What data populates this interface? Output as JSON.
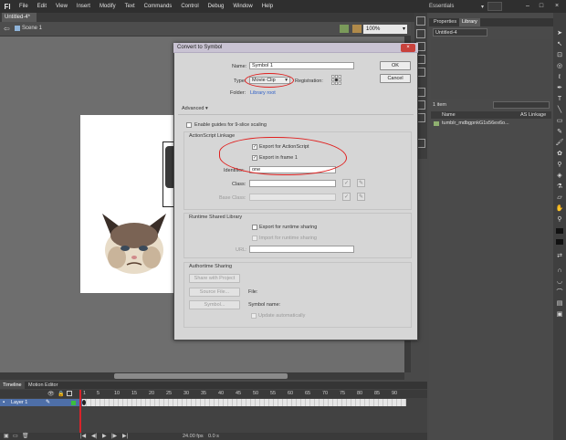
{
  "menubar": {
    "logo": "Fl",
    "items": [
      "File",
      "Edit",
      "View",
      "Insert",
      "Modify",
      "Text",
      "Commands",
      "Control",
      "Debug",
      "Window",
      "Help"
    ],
    "workspace": "Essentials",
    "minimize": "–",
    "maximize": "□",
    "close": "×"
  },
  "document": {
    "tab": "Untitled-4*",
    "scene": "Scene 1",
    "zoom": "100%"
  },
  "right_panel": {
    "tabs": [
      "Properties",
      "Library"
    ],
    "active_tab": "Library",
    "library_select": "Untitled-4",
    "item_count": "1 item",
    "columns": [
      "Name",
      "AS Linkage"
    ],
    "items": [
      "tumblr_mdbgpnkG1s56ex6o..."
    ]
  },
  "timeline": {
    "tabs": [
      "Timeline",
      "Motion Editor"
    ],
    "layer": "Layer 1",
    "ruler": [
      "1",
      "5",
      "10",
      "15",
      "20",
      "25",
      "30",
      "35",
      "40",
      "45",
      "50",
      "55",
      "60",
      "65",
      "70",
      "75",
      "80",
      "85",
      "90"
    ],
    "fps": "24.00 fps",
    "time": "0.0 s"
  },
  "dialog": {
    "title": "Convert to Symbol",
    "close": "×",
    "name_label": "Name:",
    "name_value": "Symbol 1",
    "ok": "OK",
    "cancel": "Cancel",
    "type_label": "Type:",
    "type_value": "Movie Clip",
    "registration_label": "Registration:",
    "folder_label": "Folder:",
    "folder_value": "Library root",
    "advanced": "Advanced",
    "guides": "Enable guides for 9-slice scaling",
    "as_title": "ActionScript Linkage",
    "export_as": "Export for ActionScript",
    "export_frame": "Export in frame 1",
    "identifier_label": "Identifier:",
    "identifier_value": "one",
    "class_label": "Class:",
    "base_class_label": "Base Class:",
    "rsl_title": "Runtime Shared Library",
    "export_runtime": "Export for runtime sharing",
    "import_runtime": "Import for runtime sharing",
    "url_label": "URL:",
    "authortime_title": "Authortime Sharing",
    "share_project": "Share with Project",
    "source_file": "Source File...",
    "symbol": "Symbol...",
    "file_label": "File:",
    "symbol_name_label": "Symbol name:",
    "update_auto": "Update automatically"
  }
}
